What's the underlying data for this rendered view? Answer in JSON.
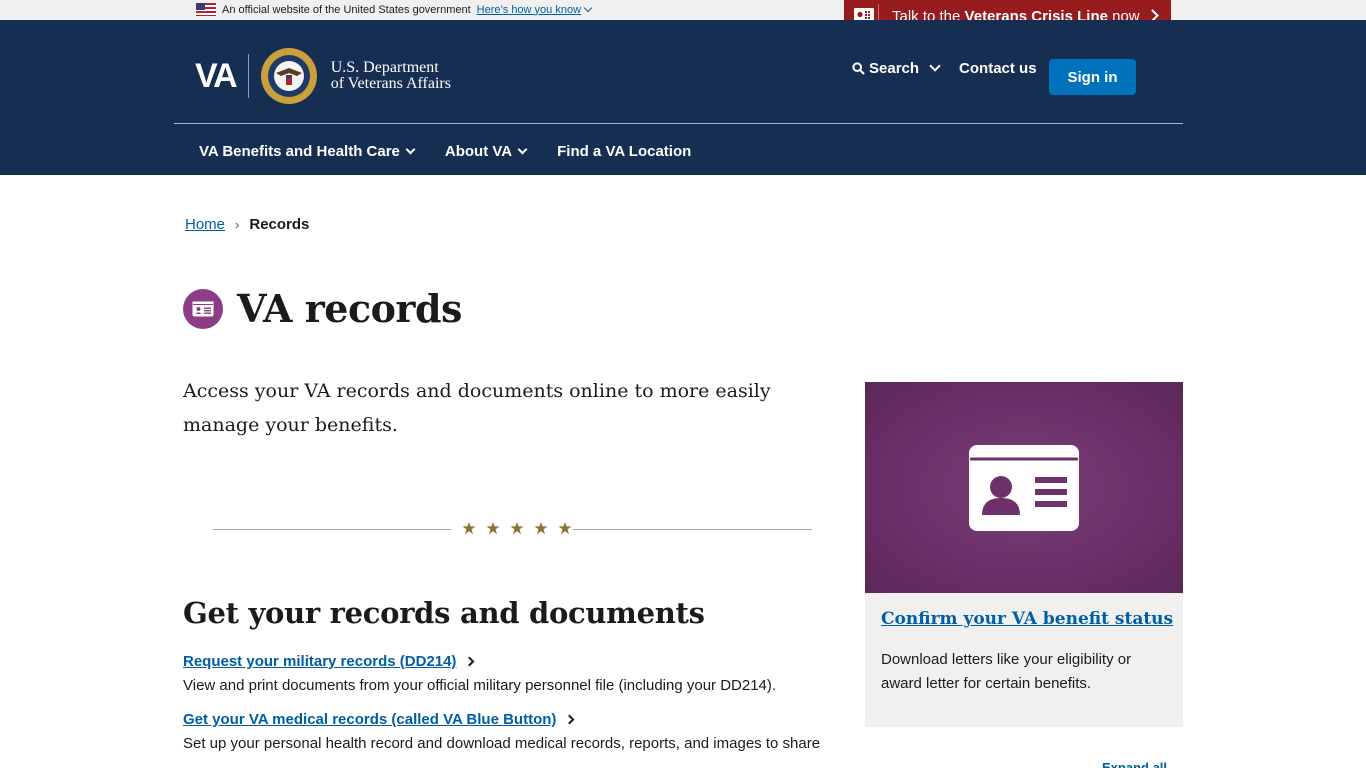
{
  "gov_banner": {
    "text": "An official website of the United States government",
    "link": "Here’s how you know"
  },
  "crisis_line": {
    "prefix": "Talk to the ",
    "bold": "Veterans Crisis Line",
    "suffix": " now"
  },
  "header": {
    "logo_text": "VA",
    "dept_line1": "U.S. Department",
    "dept_line2": "of Veterans Affairs",
    "search_label": "Search",
    "contact_label": "Contact us",
    "signin_label": "Sign in"
  },
  "nav": {
    "items": [
      {
        "label": "VA Benefits and Health Care"
      },
      {
        "label": "About VA"
      },
      {
        "label": "Find a VA Location"
      }
    ]
  },
  "breadcrumb": {
    "home": "Home",
    "separator": "›",
    "current": "Records"
  },
  "page": {
    "title": "VA records",
    "intro": "Access your VA records and documents online to more easily manage your benefits.",
    "section_heading": "Get your records and documents",
    "links": [
      {
        "label": "Request your military records (DD214)",
        "desc": "View and print documents from your official military personnel file (including your DD214)."
      },
      {
        "label": "Get your VA medical records (called VA Blue Button)",
        "desc": "Set up your personal health record and download medical records, reports, and images to share"
      }
    ],
    "expand_all": "Expand all"
  },
  "card": {
    "link": "Confirm your VA benefit status",
    "desc": "Download letters like your eligibility or award letter for certain benefits."
  },
  "colors": {
    "header_bg": "#162e51",
    "crisis_bg": "#981b1e",
    "signin_bg": "#0071bb",
    "link": "#005ea2",
    "hub_purple": "#8b3e85",
    "star_gold": "#8a7237"
  },
  "icons": {
    "flag": "us-flag-icon",
    "crisis": "crisis-line-phone-icon",
    "search": "search-icon",
    "records": "id-card-icon",
    "star": "star-icon"
  }
}
